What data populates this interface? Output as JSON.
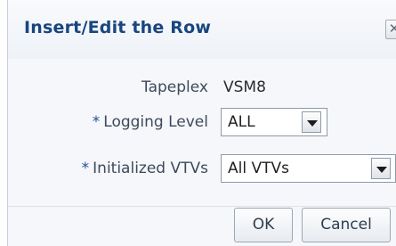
{
  "dialog": {
    "title": "Insert/Edit the Row",
    "close_icon": "close-icon"
  },
  "form": {
    "tapeplex": {
      "label": "Tapeplex",
      "value": "VSM8"
    },
    "logging_level": {
      "required_mark": "*",
      "label": "Logging Level",
      "selected": "ALL"
    },
    "initialized_vtvs": {
      "required_mark": "*",
      "label": "Initialized VTVs",
      "selected": "All VTVs"
    }
  },
  "buttons": {
    "ok": "OK",
    "cancel": "Cancel"
  },
  "colors": {
    "title": "#18467f",
    "required": "#1f4f9a",
    "label": "#3d4a5c"
  }
}
